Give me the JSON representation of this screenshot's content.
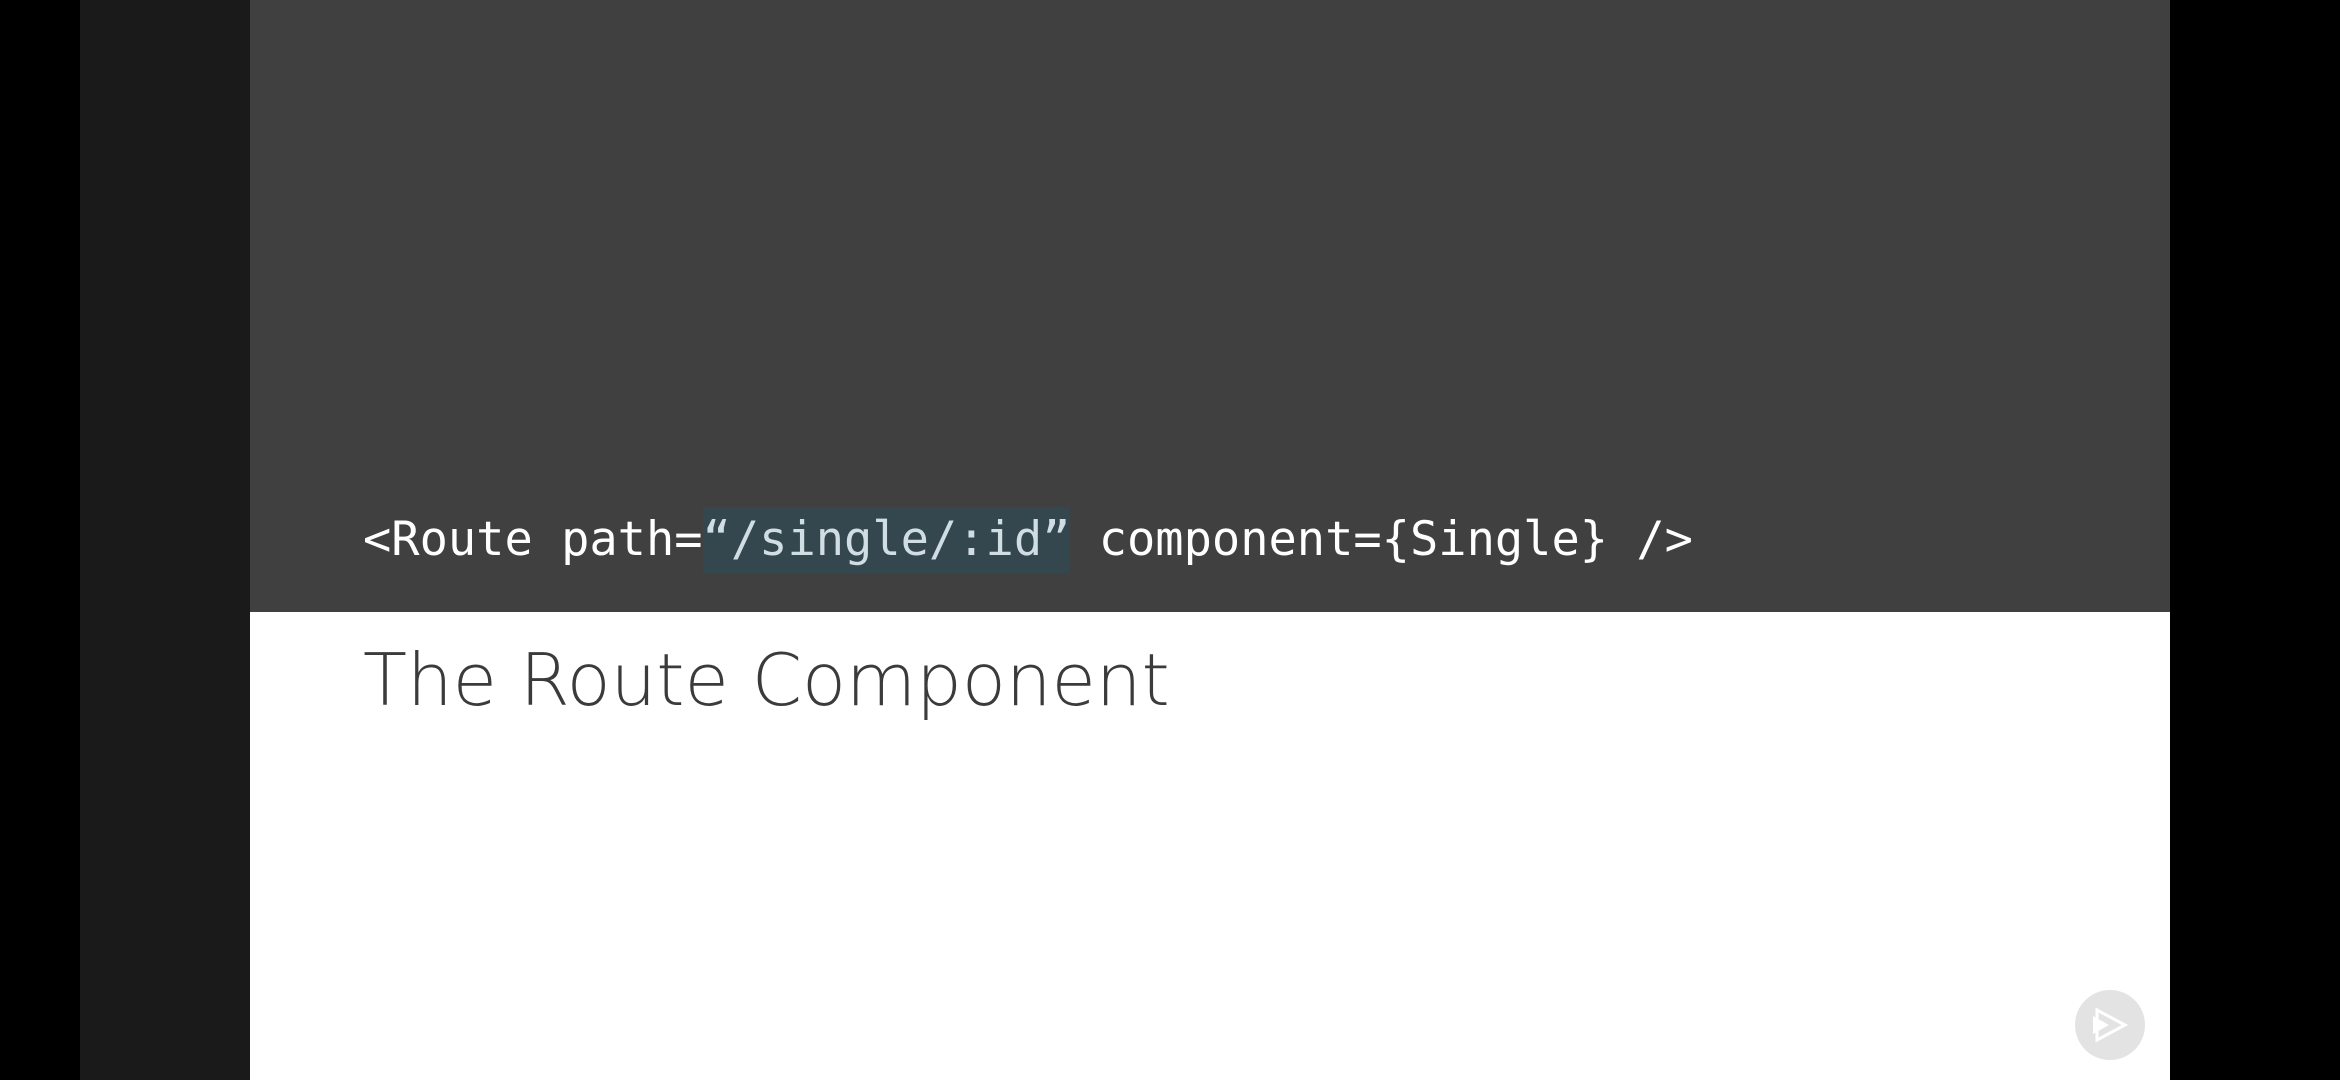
{
  "slide": {
    "code": {
      "before": "<Route path=",
      "highlight": "“/single/:id”",
      "after": " component={Single} />"
    },
    "title": "The Route Component"
  },
  "colors": {
    "code_background": "#404040",
    "slide_background": "#ffffff",
    "highlight_background": "#34474f",
    "pillarbox": "#1a1a1a"
  },
  "icons": {
    "watermark": "play-logo-icon"
  }
}
